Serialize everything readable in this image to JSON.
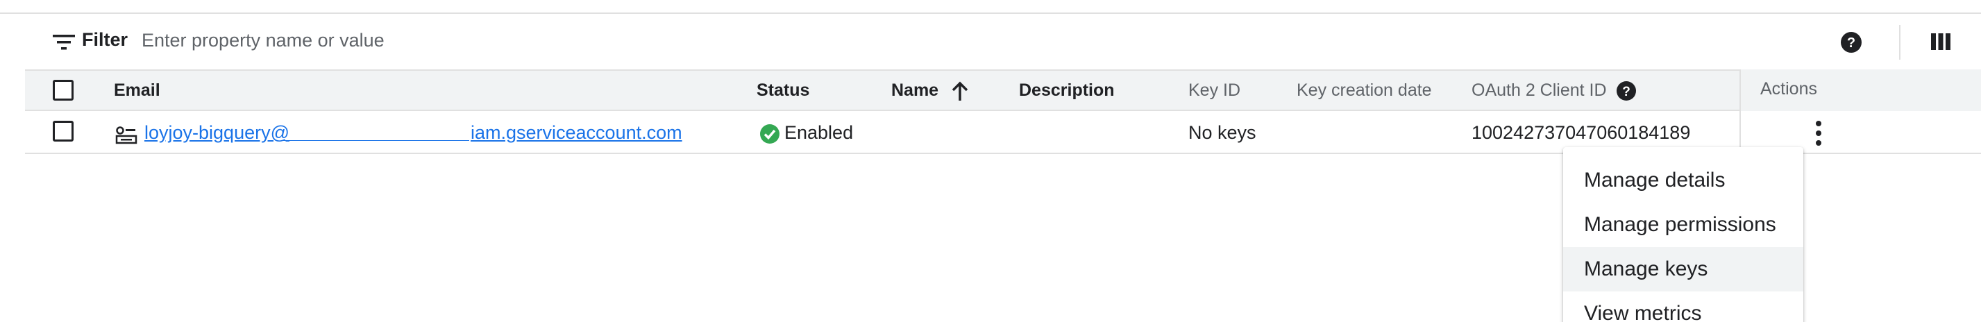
{
  "filter": {
    "label": "Filter",
    "placeholder": "Enter property name or value",
    "icon": "filter-icon"
  },
  "toolbar": {
    "help_icon": "help-icon",
    "columns_icon": "column-display-icon"
  },
  "table": {
    "columns": {
      "email": "Email",
      "status": "Status",
      "name": "Name",
      "description": "Description",
      "key_id": "Key ID",
      "key_creation_date": "Key creation date",
      "oauth_client_id": "OAuth 2 Client ID",
      "actions": "Actions"
    },
    "sort": {
      "column": "Name",
      "direction": "ascending"
    },
    "rows": [
      {
        "email_prefix": "loyjoy-bigquery@",
        "email_suffix": "iam.gserviceaccount.com",
        "status": "Enabled",
        "name": "",
        "description": "",
        "key_id": "No keys",
        "key_creation_date": "",
        "oauth_client_id": "100242737047060184189"
      }
    ]
  },
  "menu": {
    "items": [
      {
        "label": "Manage details"
      },
      {
        "label": "Manage permissions"
      },
      {
        "label": "Manage keys",
        "highlighted": true
      },
      {
        "label": "View metrics"
      }
    ]
  },
  "colors": {
    "link": "#1a73e8",
    "status_ok": "#34a853",
    "header_bg": "#f1f3f4",
    "border": "#e0e0e0"
  }
}
